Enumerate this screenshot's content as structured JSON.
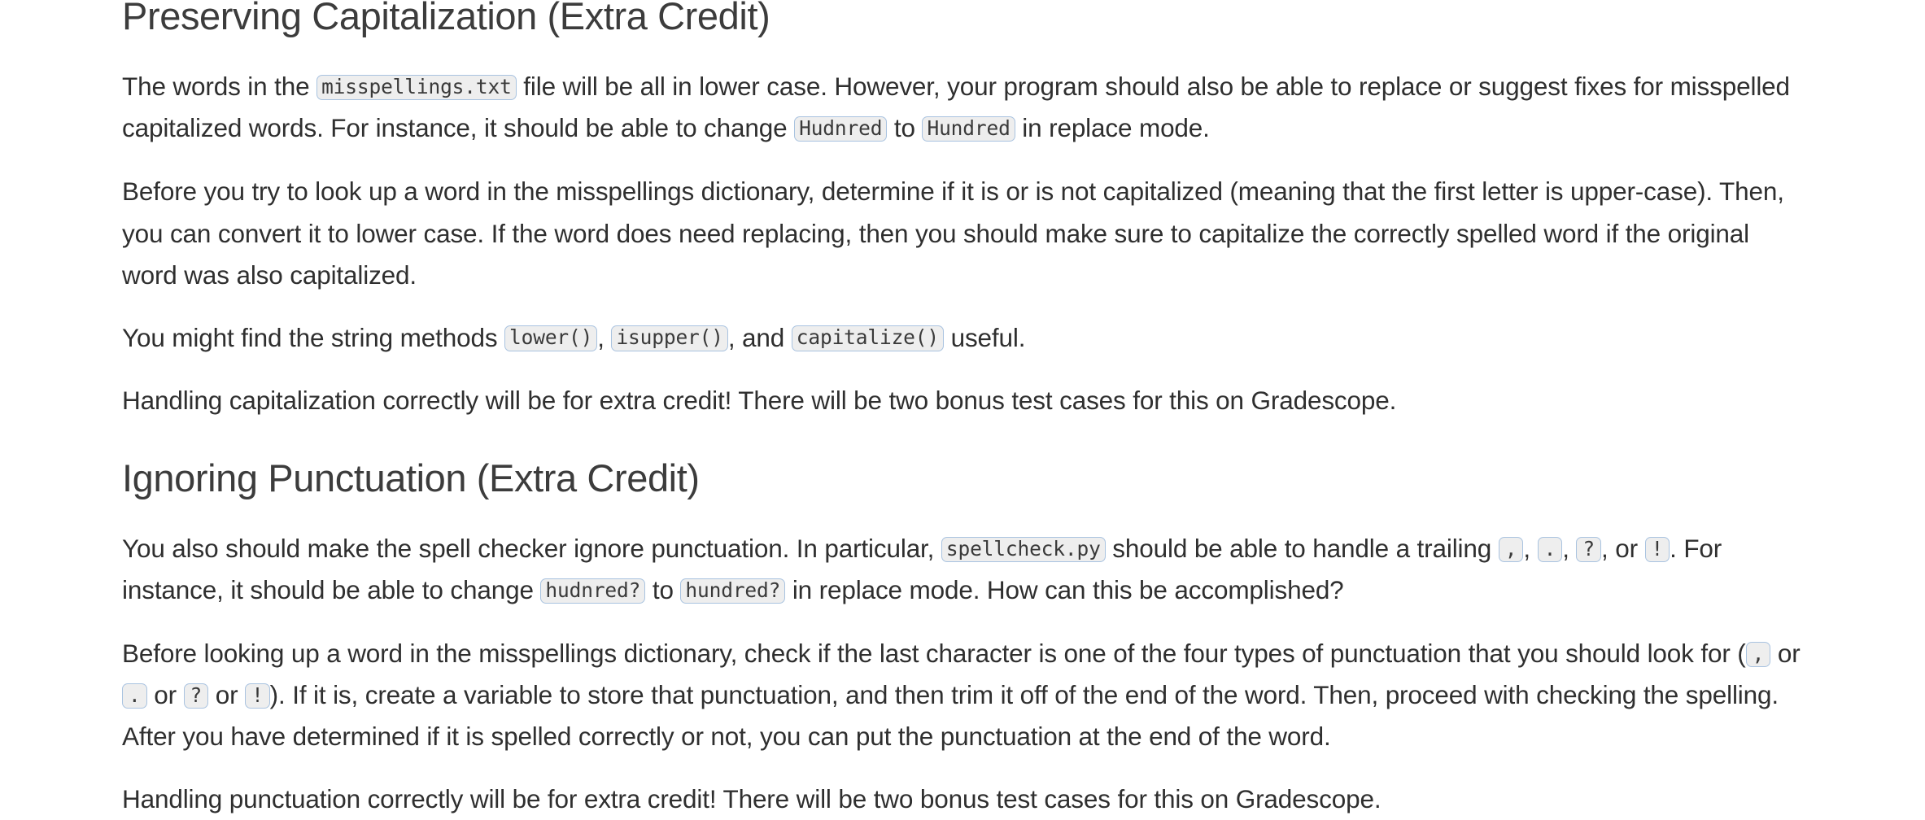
{
  "document": {
    "sections": [
      {
        "id": "preserving-capitalization",
        "heading": "Preserving Capitalization (Extra Credit)",
        "paragraphs": [
          {
            "id": "p-misspellings-file",
            "parts": [
              {
                "type": "text",
                "value": "The words in the "
              },
              {
                "type": "code",
                "value": "misspellings.txt"
              },
              {
                "type": "text",
                "value": " file will be all in lower case. However, your program should also be able to replace or suggest fixes for misspelled capitalized words. For instance, it should be able to change "
              },
              {
                "type": "code",
                "value": "Hudnred"
              },
              {
                "type": "text",
                "value": " to "
              },
              {
                "type": "code",
                "value": "Hundred"
              },
              {
                "type": "text",
                "value": " in replace mode."
              }
            ]
          },
          {
            "id": "p-before-you-try",
            "parts": [
              {
                "type": "text",
                "value": "Before you try to look up a word in the misspellings dictionary, determine if it is or is not capitalized (meaning that the first letter is upper-case). Then, you can convert it to lower case. If the word does need replacing, then you should make sure to capitalize the correctly spelled word if the original word was also capitalized."
              }
            ]
          },
          {
            "id": "p-string-methods",
            "parts": [
              {
                "type": "text",
                "value": "You might find the string methods "
              },
              {
                "type": "code",
                "value": "lower()"
              },
              {
                "type": "text",
                "value": ", "
              },
              {
                "type": "code",
                "value": "isupper()"
              },
              {
                "type": "text",
                "value": ", and "
              },
              {
                "type": "code",
                "value": "capitalize()"
              },
              {
                "type": "text",
                "value": " useful."
              }
            ]
          },
          {
            "id": "p-handling-capitalization",
            "parts": [
              {
                "type": "text",
                "value": "Handling capitalization correctly will be for extra credit! There will be two bonus test cases for this on Gradescope."
              }
            ]
          }
        ]
      },
      {
        "id": "ignoring-punctuation",
        "heading": "Ignoring Punctuation (Extra Credit)",
        "paragraphs": [
          {
            "id": "p-spell-checker-ignore",
            "parts": [
              {
                "type": "text",
                "value": "You also should make the spell checker ignore punctuation. In particular, "
              },
              {
                "type": "code",
                "value": "spellcheck.py"
              },
              {
                "type": "text",
                "value": " should be able to handle a trailing "
              },
              {
                "type": "code-punct",
                "value": ","
              },
              {
                "type": "text",
                "value": ", "
              },
              {
                "type": "code-punct",
                "value": "."
              },
              {
                "type": "text",
                "value": ", "
              },
              {
                "type": "code-punct",
                "value": "?"
              },
              {
                "type": "text",
                "value": ", or "
              },
              {
                "type": "code-punct",
                "value": "!"
              },
              {
                "type": "text",
                "value": ". For instance, it should be able to change "
              },
              {
                "type": "code",
                "value": "hudnred?"
              },
              {
                "type": "text",
                "value": " to "
              },
              {
                "type": "code",
                "value": "hundred?"
              },
              {
                "type": "text",
                "value": " in replace mode. How can this be accomplished?"
              }
            ]
          },
          {
            "id": "p-before-looking-up",
            "parts": [
              {
                "type": "text",
                "value": "Before looking up a word in the misspellings dictionary, check if the last character is one of the four types of punctuation that you should look for ("
              },
              {
                "type": "code-punct",
                "value": ","
              },
              {
                "type": "text",
                "value": " or "
              },
              {
                "type": "code-punct",
                "value": "."
              },
              {
                "type": "text",
                "value": " or "
              },
              {
                "type": "code-punct",
                "value": "?"
              },
              {
                "type": "text",
                "value": " or "
              },
              {
                "type": "code-punct",
                "value": "!"
              },
              {
                "type": "text",
                "value": "). If it is, create a variable to store that punctuation, and then trim it off of the end of the word. Then, proceed with checking the spelling. After you have determined if it is spelled correctly or not, you can put the punctuation at the end of the word."
              }
            ]
          },
          {
            "id": "p-handling-punctuation",
            "parts": [
              {
                "type": "text",
                "value": "Handling punctuation correctly will be for extra credit! There will be two bonus test cases for this on Gradescope."
              }
            ]
          }
        ]
      }
    ]
  },
  "style": {
    "background": "#ffffff",
    "text_color": "#2f2f2f",
    "heading_color": "#3c3c3c",
    "code_background": "#eeeeee",
    "code_border": "#a9c3e0"
  }
}
